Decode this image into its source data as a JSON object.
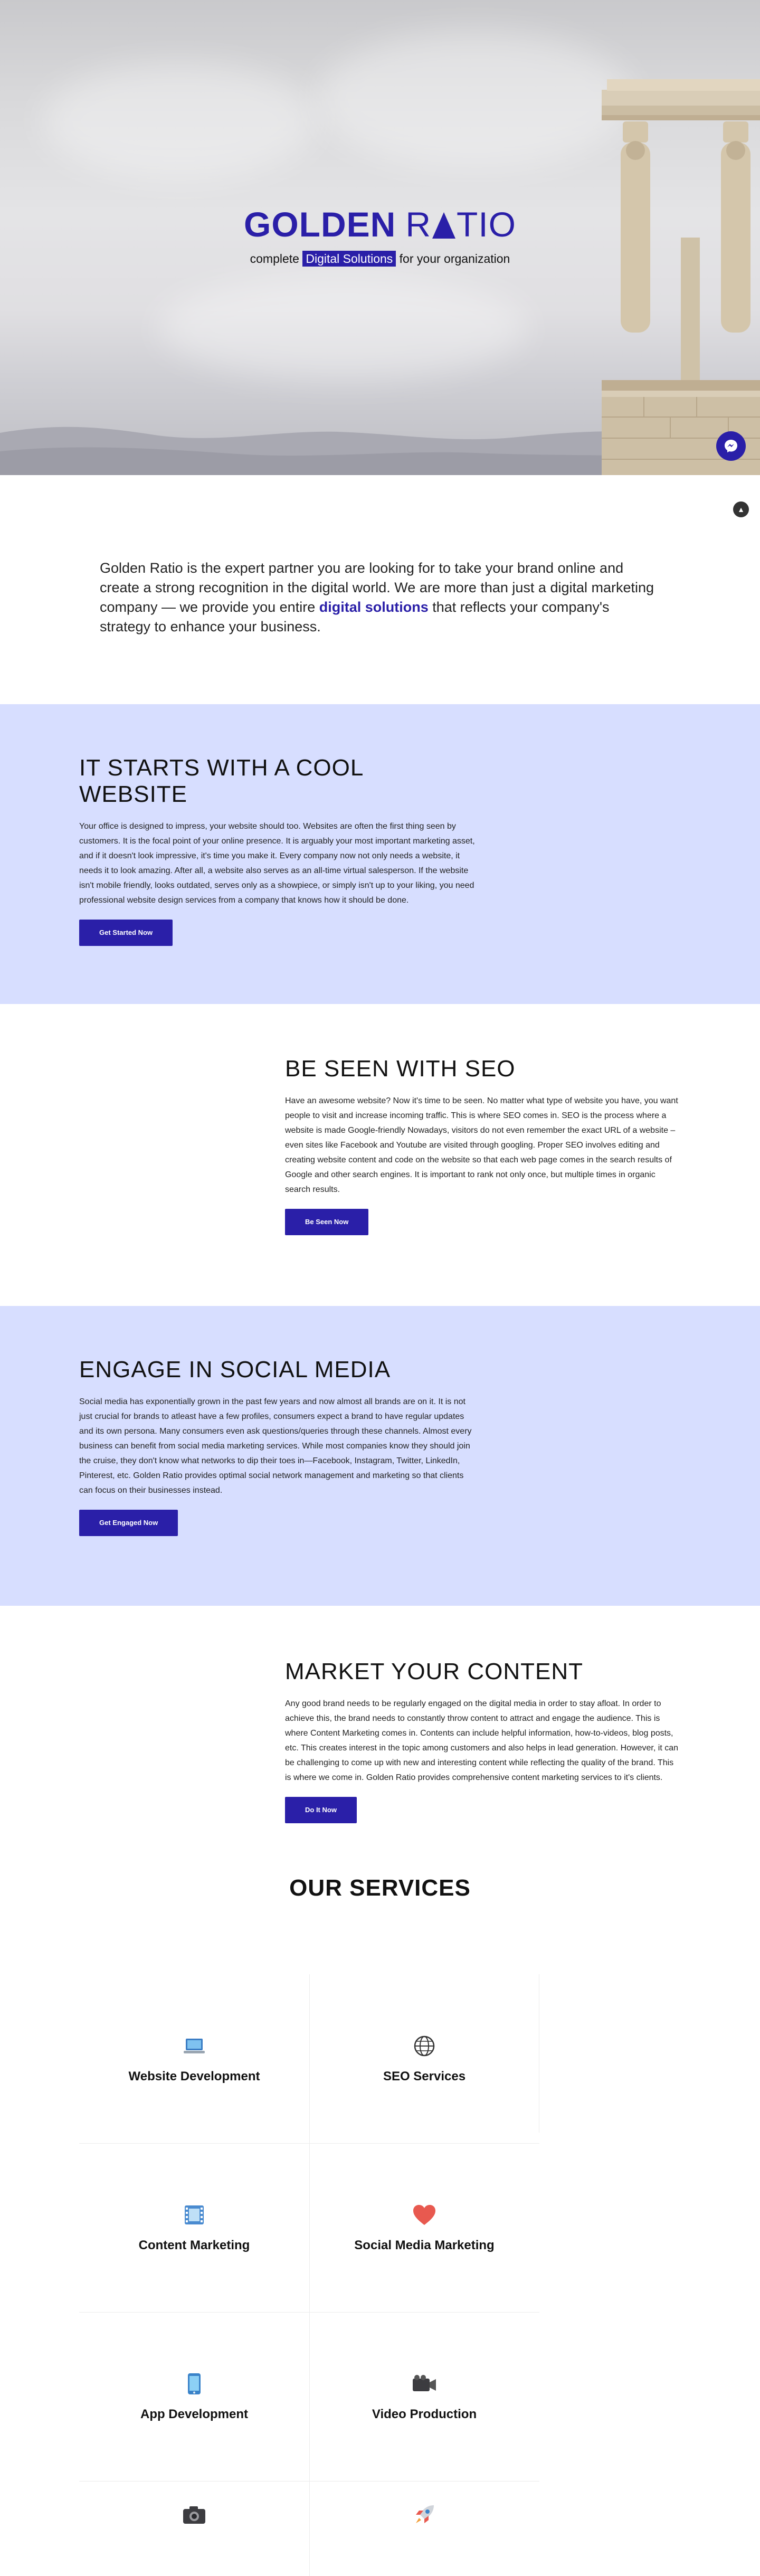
{
  "hero": {
    "logo_first": "GOLDEN",
    "logo_r": "R",
    "logo_rest": "TIO",
    "tag_before": "complete",
    "tag_highlight": "Digital Solutions",
    "tag_after": "for your organization"
  },
  "intro": {
    "text_before": "Golden Ratio is the expert partner you are looking for to take your brand online and create a strong recognition in the digital world. We are more than just a digital marketing company — we provide  you entire ",
    "emphasis": "digital solutions",
    "text_after": " that reflects your company's strategy to enhance your business."
  },
  "sections": [
    {
      "title": "IT STARTS WITH A COOL WEBSITE",
      "body": "Your office is designed to impress, your website should too. Websites are often the first thing seen by customers. It is the focal point of your online presence. It is arguably your most important marketing asset, and if it doesn't look impressive, it's time you make it. Every company now not only needs a website, it needs it to look amazing. After all, a website also serves as an all-time virtual salesperson. If the website isn't mobile friendly, looks outdated, serves only as a showpiece, or simply isn't up to your liking, you need professional website design services from a company that knows how it should be done.",
      "cta": "Get Started Now"
    },
    {
      "title": "BE SEEN WITH SEO",
      "body": "Have an awesome website? Now it's time to be seen. No matter what type of website you have, you want people to visit and increase incoming traffic. This is where SEO comes in. SEO is the process where a website is made Google-friendly Nowadays, visitors do not even remember the exact URL of a website – even sites like Facebook and Youtube are visited through googling. Proper SEO involves editing and creating website content and code on the website so that each web page comes in the search results of Google and other search engines. It is important to rank not only once, but multiple times in organic search results.",
      "cta": "Be Seen Now"
    },
    {
      "title": "ENGAGE IN SOCIAL MEDIA",
      "body": "Social media has exponentially grown in the past few years and now almost all brands are on it. It is not just crucial for brands to atleast have a few profiles, consumers expect a brand to have regular updates and its own persona. Many consumers even ask questions/queries through these channels. Almost every business can benefit from social media marketing services. While most companies know they should join the cruise, they don't know what networks to dip their toes in—Facebook, Instagram, Twitter, LinkedIn, Pinterest, etc. Golden Ratio provides optimal social network management and marketing so that clients can focus on their businesses instead.",
      "cta": "Get Engaged Now"
    },
    {
      "title": "MARKET YOUR CONTENT",
      "body": "Any good brand needs to be regularly engaged on the digital media in order to stay afloat. In order to achieve this, the brand needs to constantly throw content to attract and engage the audience. This is where Content Marketing comes in. Contents can include helpful information, how-to-videos, blog posts, etc. This creates interest in the topic among customers and also helps in lead generation. However, it can be challenging to come up with new and interesting content while reflecting the quality of the brand. This is where we come in. Golden Ratio provides comprehensive content marketing services to it's clients.",
      "cta": "Do It Now"
    }
  ],
  "services": {
    "title": "OUR SERVICES",
    "items": [
      {
        "label": "Website Development",
        "icon": "laptop-icon"
      },
      {
        "label": "SEO Services",
        "icon": "globe-icon"
      },
      {
        "label": "Content Marketing",
        "icon": "film-icon"
      },
      {
        "label": "Social Media Marketing",
        "icon": "heart-icon"
      },
      {
        "label": "App Development",
        "icon": "phone-icon"
      },
      {
        "label": "Video Production",
        "icon": "video-camera-icon"
      },
      {
        "label": "",
        "icon": "camera-icon"
      },
      {
        "label": "",
        "icon": "rocket-icon"
      }
    ]
  },
  "colors": {
    "brand": "#2a1fa8",
    "band": "#d7deff"
  }
}
